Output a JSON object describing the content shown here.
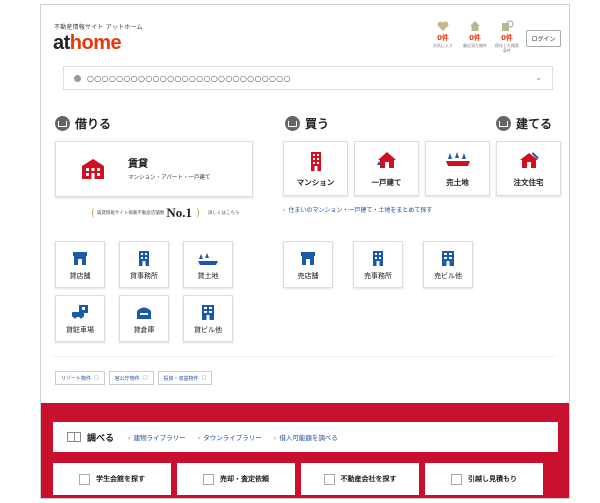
{
  "header": {
    "tagline": "不動産情報サイト アットホーム",
    "logo_at": "at",
    "logo_home": "home",
    "icons": [
      {
        "name": "heart-icon",
        "count": "0件",
        "caption": "お気に入り"
      },
      {
        "name": "house-icon",
        "count": "0件",
        "caption": "最近見た物件"
      },
      {
        "name": "search-save-icon",
        "count": "0件",
        "caption": "保存した検索条件"
      }
    ],
    "login_label": "ログイン"
  },
  "address_bar": {
    "text": "○○○○○○○○○○○○○○○○○○○○○○○○○○○○"
  },
  "sections": {
    "rent": "借りる",
    "buy": "買う",
    "build": "建てる"
  },
  "rent": {
    "big_card_title": "賃貸",
    "big_card_sub": "マンション・アパート・一戸建て",
    "no1_text": "賃貸情報サイト掲載不動産店舗数",
    "no1_big": "No.1",
    "no1_more": "詳しくはこちら",
    "cards": [
      {
        "label": "貸店舗",
        "icon": "shop-icon"
      },
      {
        "label": "貸事務所",
        "icon": "office-icon"
      },
      {
        "label": "貸土地",
        "icon": "land-icon"
      },
      {
        "label": "貸駐車場",
        "icon": "parking-icon"
      },
      {
        "label": "貸倉庫",
        "icon": "warehouse-icon"
      },
      {
        "label": "貸ビル他",
        "icon": "building-icon"
      }
    ],
    "tags": [
      "リゾート物件",
      "官公庁物件",
      "投資・収益物件"
    ]
  },
  "buy": {
    "cards": [
      {
        "label": "マンション",
        "icon": "mansion-icon"
      },
      {
        "label": "一戸建て",
        "icon": "house-icon"
      },
      {
        "label": "売土地",
        "icon": "land-icon"
      }
    ],
    "link": "住まいのマンション・一戸建て・土地をまとめて探す",
    "cards2": [
      {
        "label": "売店舗",
        "icon": "shop-icon"
      },
      {
        "label": "売事務所",
        "icon": "office-icon"
      },
      {
        "label": "売ビル他",
        "icon": "building-icon"
      }
    ]
  },
  "build": {
    "card": {
      "label": "注文住宅",
      "icon": "custom-house-icon"
    }
  },
  "research": {
    "heading": "調べる",
    "links": [
      "建物ライブラリー",
      "タウンライブラリー",
      "借入可能額を調べる"
    ]
  },
  "bottom_buttons": [
    {
      "label": "学生会館を探す",
      "icon": "dorm-icon"
    },
    {
      "label": "売却・査定依頼",
      "icon": "document-icon"
    },
    {
      "label": "不動産会社を探す",
      "icon": "agency-icon"
    },
    {
      "label": "引越し見積もり",
      "icon": "truck-icon"
    }
  ],
  "colors": {
    "brand_red": "#e8380d",
    "footer_red": "#c8102e",
    "icon_blue": "#1a5aa8",
    "icon_red": "#d0101e",
    "link_blue": "#1a4d9c"
  }
}
